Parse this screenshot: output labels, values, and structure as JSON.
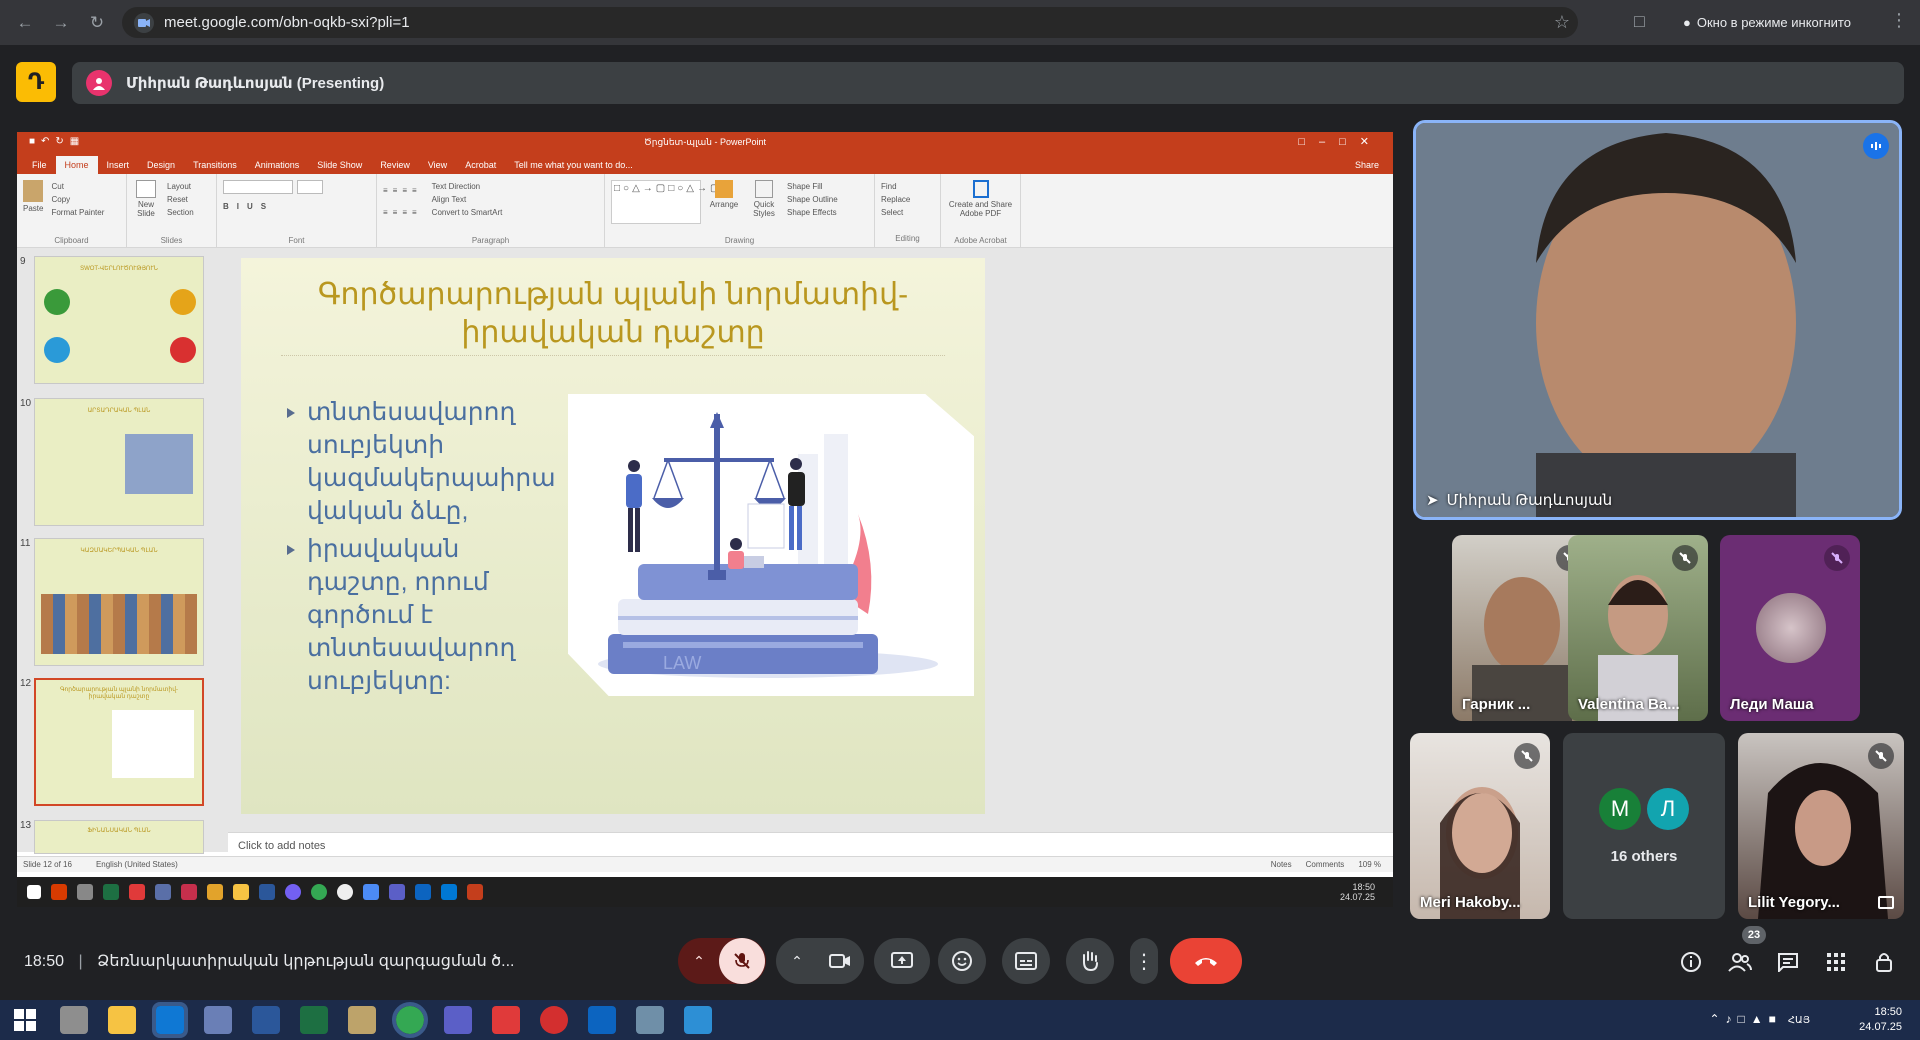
{
  "browser": {
    "url": "meet.google.com/obn-oqkb-sxi?pli=1",
    "incognito_label": "Окно в режиме инкогнито"
  },
  "meet": {
    "presenting_label": "Միհրան Թադևոսյան (Presenting)",
    "meeting_time": "18:50",
    "meeting_title": "Ձեռնարկատիրական կրթության զարգացման ծ...",
    "participant_count": "23",
    "others_label": "16 others",
    "others_initials": [
      "M",
      "Л"
    ],
    "main_speaker": "Միհրան Թադևոսյան",
    "participants": [
      {
        "name": "Гарник ..."
      },
      {
        "name": "Valentina Ba..."
      },
      {
        "name": "Леди Маша"
      },
      {
        "name": "Meri Hakoby..."
      },
      {
        "name": "Lilit Yegory..."
      }
    ],
    "colors": {
      "accent": "#8ab4f8",
      "end_call": "#ea4335",
      "mic_off": "#f9dedc"
    }
  },
  "ppt": {
    "window_title": "Ծրցնետ-պլան - PowerPoint",
    "tabs": [
      "File",
      "Home",
      "Insert",
      "Design",
      "Transitions",
      "Animations",
      "Slide Show",
      "Review",
      "View",
      "Acrobat",
      "Tell me what you want to do..."
    ],
    "share_label": "Share",
    "ribbon": {
      "paste": "Paste",
      "cut": "Cut",
      "copy": "Copy",
      "format_painter": "Format Painter",
      "clipboard": "Clipboard",
      "new_slide": "New Slide",
      "layout": "Layout",
      "reset": "Reset",
      "section": "Section",
      "slides": "Slides",
      "font": "Font",
      "text_direction": "Text Direction",
      "align_text": "Align Text",
      "convert_smartart": "Convert to SmartArt",
      "paragraph": "Paragraph",
      "arrange": "Arrange",
      "quick_styles": "Quick Styles",
      "shape_fill": "Shape Fill",
      "shape_outline": "Shape Outline",
      "shape_effects": "Shape Effects",
      "drawing": "Drawing",
      "find": "Find",
      "replace": "Replace",
      "select": "Select",
      "editing": "Editing",
      "create_pdf": "Create and Share Adobe PDF",
      "adobe": "Adobe Acrobat"
    },
    "thumbnails": [
      {
        "num": "9",
        "title": "SWOT-ՎԵՐԼՈՒԾՈՒԹՅՈՒՆ"
      },
      {
        "num": "10",
        "title": "ԱՐՏԱԴՐԱԿԱՆ ՊԼԱՆ"
      },
      {
        "num": "11",
        "title": "ԿԱԶՄԱԿԵՐՊԱԿԱՆ ՊԼԱՆ"
      },
      {
        "num": "12",
        "title": "Գործարարության պլանի նորմատիվ-իրավական դաշտը"
      },
      {
        "num": "13",
        "title": "ՖԻՆԱՆՍԱԿԱՆ ՊԼԱՆ"
      }
    ],
    "slide": {
      "title_line1": "Գործարարության պլանի նորմատիվ-",
      "title_line2": "իրավական դաշտը",
      "bullet1": "տնտեսավարող սուբյեկտի կազմակերպաիրա վական ձևը,",
      "bullet2": "իրավական դաշտը, որում գործում է տնտեսավարող սուբյեկտը:",
      "book_label": "LAW"
    },
    "notes_placeholder": "Click to add notes",
    "status": {
      "slide_of": "Slide 12 of 16",
      "language": "English (United States)",
      "notes": "Notes",
      "comments": "Comments",
      "zoom": "109 %"
    },
    "remote_clock": "18:50",
    "remote_date": "24.07.25"
  },
  "os": {
    "lang": "ՀԱՅ",
    "time": "18:50",
    "date": "24.07.25"
  }
}
